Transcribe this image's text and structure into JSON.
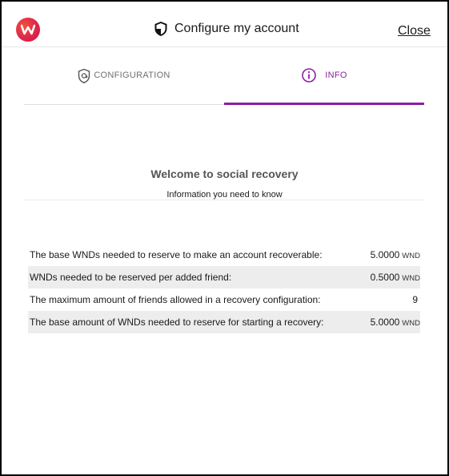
{
  "header": {
    "title": "Configure my account",
    "close_label": "Close"
  },
  "tabs": [
    {
      "label": "CONFIGURATION",
      "icon": "shield-icon",
      "active": false
    },
    {
      "label": "INFO",
      "icon": "info-icon",
      "active": true
    }
  ],
  "colors": {
    "accent": "#8b1fa3",
    "row_shade": "#ededed",
    "logo": "#e0264a"
  },
  "main": {
    "title": "Welcome to social recovery",
    "subtitle": "Information you need to know",
    "rows": [
      {
        "label": "The base WNDs needed to reserve to make an account recoverable:",
        "value": "5.0000",
        "unit": "WND"
      },
      {
        "label": "WNDs needed to be reserved per added friend:",
        "value": "0.5000",
        "unit": "WND"
      },
      {
        "label": "The maximum amount of friends allowed in a recovery configuration:",
        "value": "9",
        "unit": ""
      },
      {
        "label": "The base amount of WNDs needed to reserve for starting a recovery:",
        "value": "5.0000",
        "unit": "WND"
      }
    ]
  }
}
